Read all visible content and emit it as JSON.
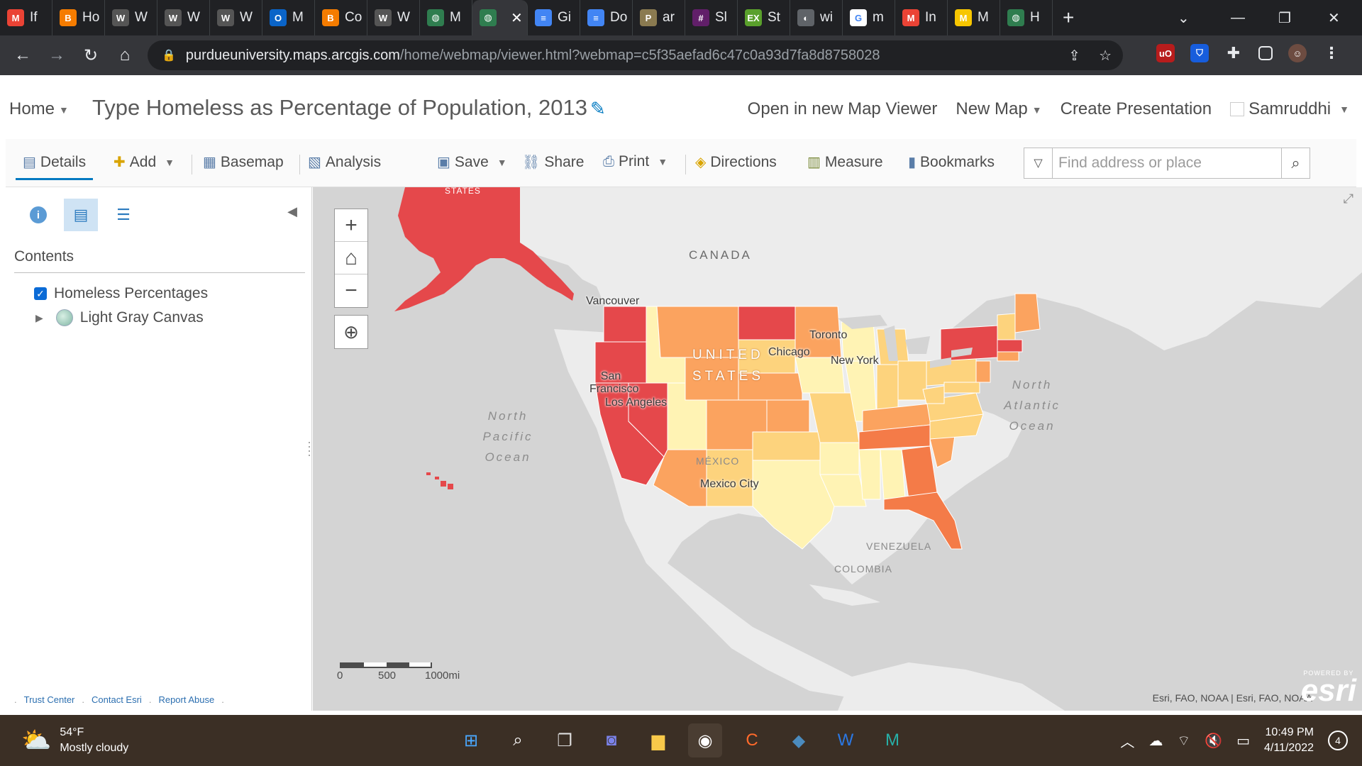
{
  "browser": {
    "tabs": [
      {
        "label": "If",
        "icon": "gmail-icon",
        "color": "#ea4335",
        "glyph": "M"
      },
      {
        "label": "Ho",
        "icon": "blogger-icon",
        "color": "#f57c00",
        "glyph": "B"
      },
      {
        "label": "W",
        "icon": "wix-icon",
        "color": "#555555",
        "glyph": "W"
      },
      {
        "label": "W",
        "icon": "wix-icon",
        "color": "#555555",
        "glyph": "W"
      },
      {
        "label": "W",
        "icon": "wix-icon",
        "color": "#555555",
        "glyph": "W"
      },
      {
        "label": "M",
        "icon": "outlook-icon",
        "color": "#0a64c8",
        "glyph": "O"
      },
      {
        "label": "Co",
        "icon": "blogger-icon",
        "color": "#f57c00",
        "glyph": "B"
      },
      {
        "label": "W",
        "icon": "wix-icon",
        "color": "#555555",
        "glyph": "W"
      },
      {
        "label": "M",
        "icon": "arcgis-globe-icon",
        "color": "#2f7d4f",
        "glyph": "◍"
      }
    ],
    "active_tab": {
      "label": "",
      "icon": "arcgis-globe-icon",
      "color": "#2f7d4f",
      "glyph": "◍"
    },
    "tabs_after": [
      {
        "label": "Gi",
        "icon": "google-docs-icon",
        "color": "#4285f4",
        "glyph": "≡"
      },
      {
        "label": "Do",
        "icon": "google-docs-icon",
        "color": "#4285f4",
        "glyph": "≡"
      },
      {
        "label": "ar",
        "icon": "purdue-icon",
        "color": "#8a7a50",
        "glyph": "P"
      },
      {
        "label": "Sl",
        "icon": "slack-icon",
        "color": "#611f69",
        "glyph": "#"
      },
      {
        "label": "St",
        "icon": "exr-icon",
        "color": "#5aa02c",
        "glyph": "EX"
      },
      {
        "label": "wi",
        "icon": "web-globe-icon",
        "color": "#5f6368",
        "glyph": "◐"
      },
      {
        "label": "m",
        "icon": "google-icon",
        "color": "#ffffff",
        "glyph": "G"
      },
      {
        "label": "In",
        "icon": "gmail-icon",
        "color": "#ea4335",
        "glyph": "M"
      },
      {
        "label": "M",
        "icon": "miro-icon",
        "color": "#f7c600",
        "glyph": "M"
      },
      {
        "label": "H",
        "icon": "arcgis-globe-icon",
        "color": "#2f7d4f",
        "glyph": "◍"
      }
    ],
    "url_host": "purdueuniversity.maps.arcgis.com",
    "url_path": "/home/webmap/viewer.html?webmap=c5f35aefad6c47c0a93d7fa8d8758028"
  },
  "viewer": {
    "home_label": "Home",
    "title": "Type Homeless as Percentage of Population, 2013",
    "open_new": "Open in new Map Viewer",
    "new_map": "New Map",
    "create_presentation": "Create Presentation",
    "user": "Samruddhi"
  },
  "toolbar": {
    "details": "Details",
    "add": "Add",
    "basemap": "Basemap",
    "analysis": "Analysis",
    "save": "Save",
    "share": "Share",
    "print": "Print",
    "directions": "Directions",
    "measure": "Measure",
    "bookmarks": "Bookmarks",
    "search_placeholder": "Find address or place"
  },
  "panel": {
    "contents_title": "Contents",
    "layers": [
      {
        "name": "Homeless Percentages",
        "checked": true
      },
      {
        "name": "Light Gray Canvas",
        "checked": false
      }
    ],
    "footer": [
      "Trust Center",
      "Contact Esri",
      "Report Abuse"
    ]
  },
  "map": {
    "labels": {
      "canada": "CANADA",
      "united_states": "UNITED STATES",
      "alaska_states": "STATES",
      "mexico": "MÉXICO",
      "venezuela": "VENEZUELA",
      "colombia": "COLOMBIA",
      "north_pacific": "North Pacific Ocean",
      "north_atlantic": "North Atlantic Ocean",
      "vancouver": "Vancouver",
      "san_francisco": "San Francisco",
      "los_angeles": "Los Angeles",
      "chicago": "Chicago",
      "toronto": "Toronto",
      "new_york": "New York",
      "mexico_city": "Mexico City"
    },
    "scale": {
      "zero": "0",
      "mid": "500",
      "end": "1000mi"
    },
    "attribution": "Esri, FAO, NOAA | Esri, FAO, NOAA",
    "powered_by": "POWERED BY",
    "esri": "esri",
    "colors": {
      "highest": "#e5484b",
      "high": "#f47b48",
      "mid": "#fba35f",
      "low": "#fdd37d",
      "lowest": "#fff3b4",
      "land": "#ececec",
      "water": "#d4d4d4"
    }
  },
  "taskbar": {
    "temperature": "54°F",
    "condition": "Mostly cloudy",
    "time": "10:49 PM",
    "date": "4/11/2022",
    "notifications": "4"
  }
}
